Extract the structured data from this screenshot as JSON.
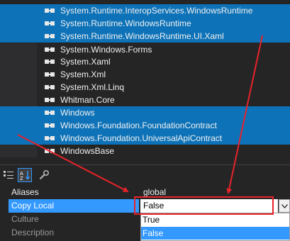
{
  "references": [
    {
      "name": "System.Runtime.InteropServices.WindowsRuntime",
      "selected": true
    },
    {
      "name": "System.Runtime.WindowsRuntime",
      "selected": true
    },
    {
      "name": "System.Runtime.WindowsRuntime.UI.Xaml",
      "selected": true
    },
    {
      "name": "System.Windows.Forms",
      "selected": false
    },
    {
      "name": "System.Xaml",
      "selected": false
    },
    {
      "name": "System.Xml",
      "selected": false
    },
    {
      "name": "System.Xml.Linq",
      "selected": false
    },
    {
      "name": "Whitman.Core",
      "selected": false
    },
    {
      "name": "Windows",
      "selected": true
    },
    {
      "name": "Windows.Foundation.FoundationContract",
      "selected": true
    },
    {
      "name": "Windows.Foundation.UniversalApiContract",
      "selected": true
    },
    {
      "name": "WindowsBase",
      "selected": false
    }
  ],
  "toolbar": {
    "icons": [
      "categorized-icon",
      "alphabetical-icon",
      "property-pages-icon"
    ]
  },
  "properties": {
    "aliases": {
      "name": "Aliases",
      "value": "global"
    },
    "copy_local": {
      "name": "Copy Local",
      "value": "False"
    },
    "culture": {
      "name": "Culture"
    },
    "description": {
      "name": "Description"
    }
  },
  "dropdown": {
    "options": [
      "True",
      "False"
    ],
    "highlighted": "False"
  },
  "colors": {
    "selection": "#0d72b8",
    "property_selection": "#3399ff",
    "annotation": "#e8232a",
    "background": "#252526"
  }
}
